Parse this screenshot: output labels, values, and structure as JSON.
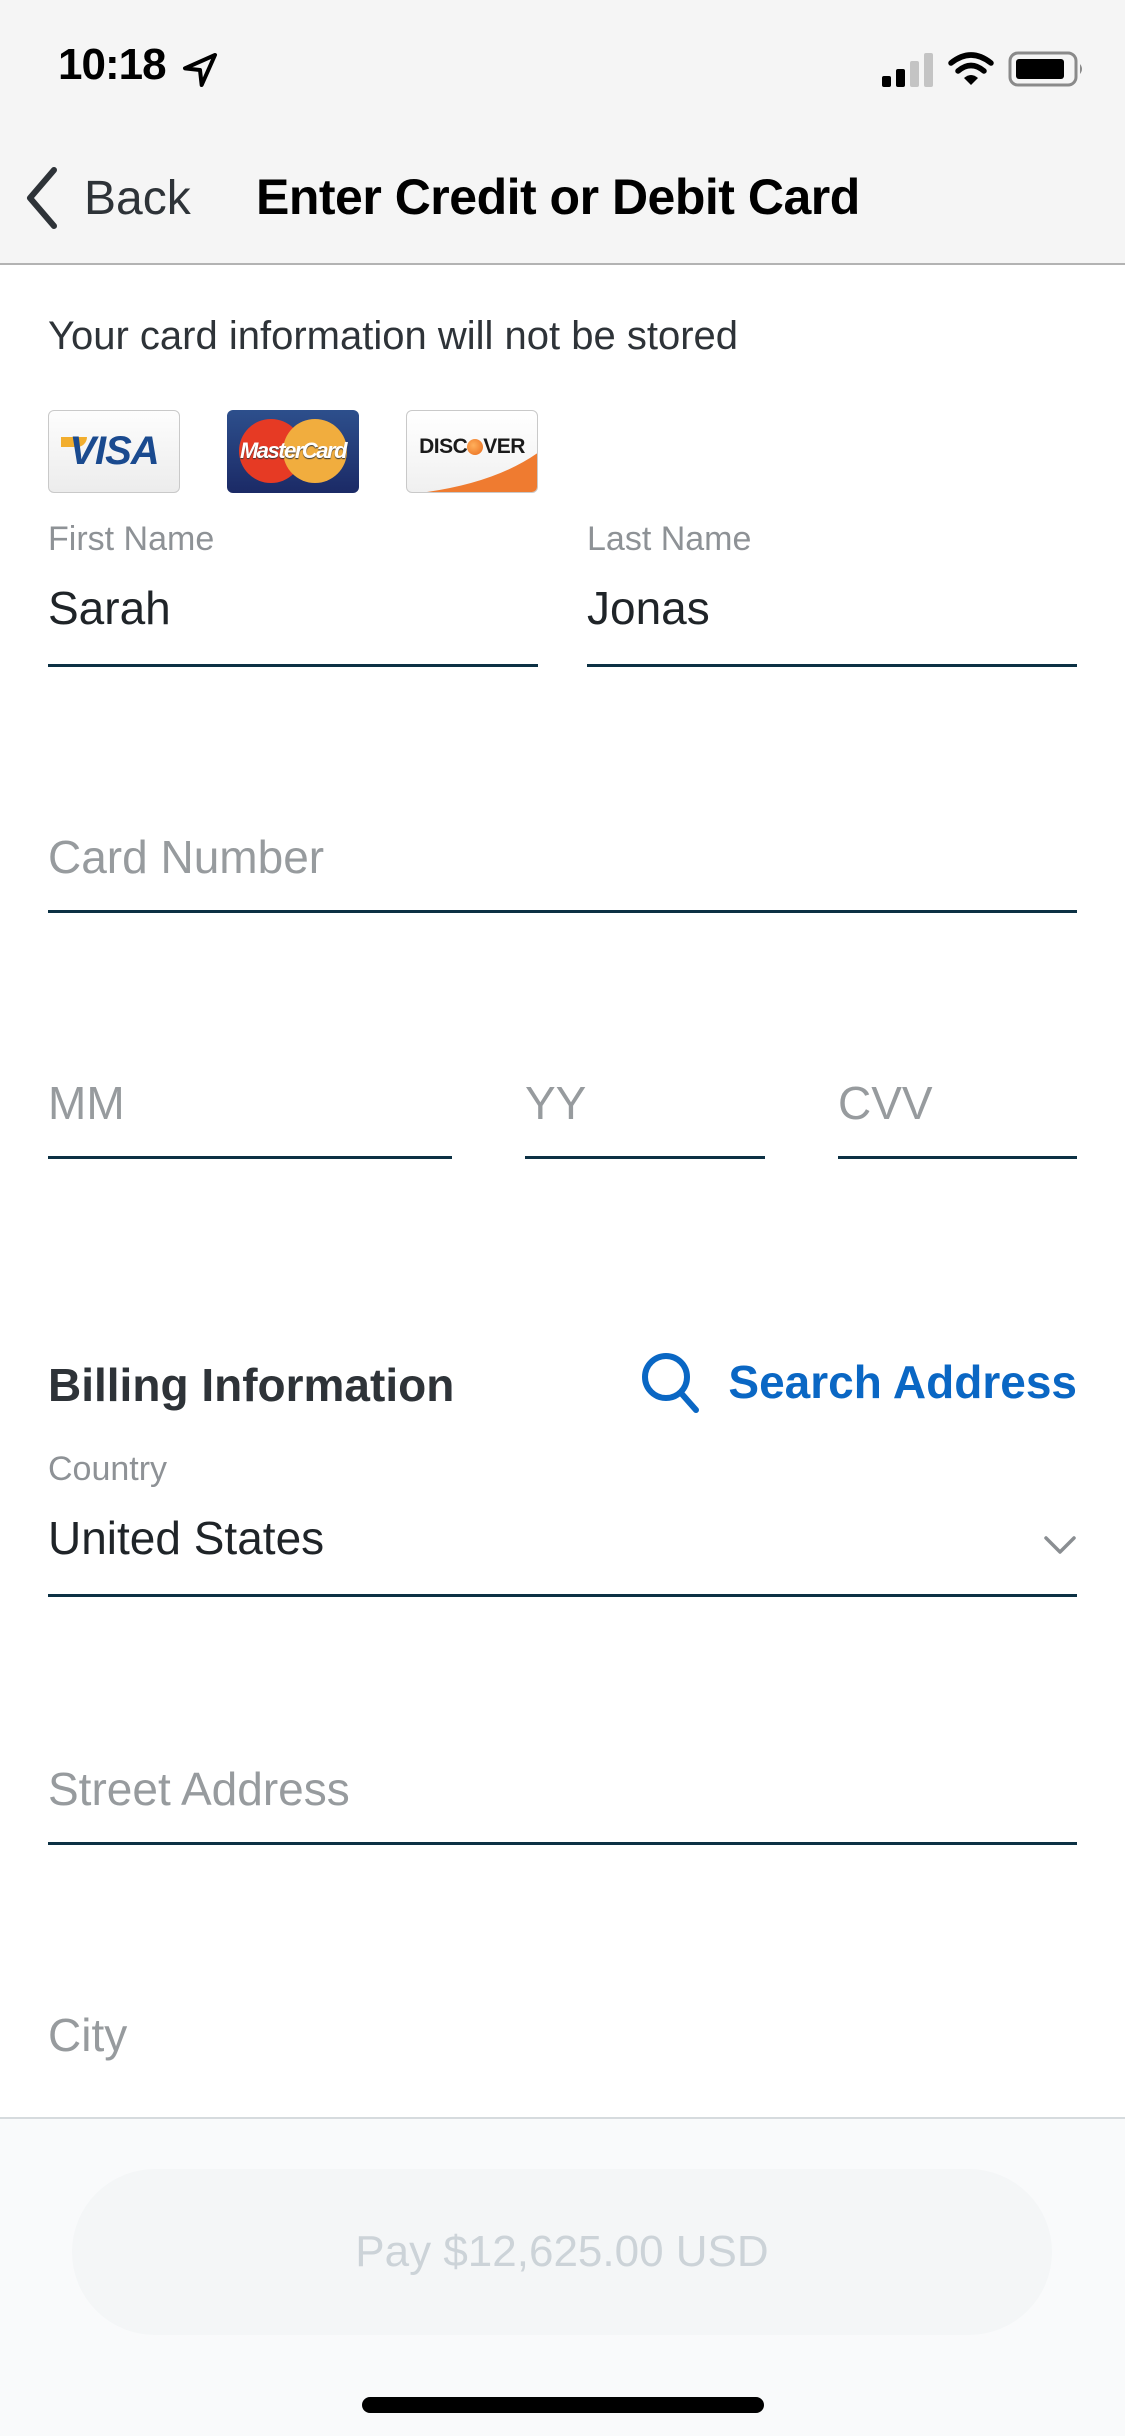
{
  "status_bar": {
    "time": "10:18",
    "icons": [
      "location-arrow-icon",
      "cellular-signal-icon",
      "wifi-icon",
      "battery-icon"
    ]
  },
  "nav": {
    "back_label": "Back",
    "title": "Enter Credit or Debit Card"
  },
  "notice": "Your card information will not be stored",
  "accepted_cards": [
    {
      "name": "visa",
      "label": "VISA"
    },
    {
      "name": "mastercard",
      "label": "MasterCard"
    },
    {
      "name": "discover",
      "label_pre": "DISC",
      "label_post": "VER"
    }
  ],
  "form": {
    "first_name": {
      "label": "First Name",
      "value": "Sarah"
    },
    "last_name": {
      "label": "Last Name",
      "value": "Jonas"
    },
    "card_number": {
      "placeholder": "Card Number"
    },
    "exp_month": {
      "placeholder": "MM"
    },
    "exp_year": {
      "placeholder": "YY"
    },
    "cvv": {
      "placeholder": "CVV"
    }
  },
  "billing": {
    "title": "Billing Information",
    "search_address_label": "Search Address",
    "country": {
      "label": "Country",
      "value": "United States"
    },
    "street_address": {
      "placeholder": "Street Address"
    },
    "city": {
      "placeholder": "City"
    }
  },
  "pay_button": {
    "label": "Pay $12,625.00 USD",
    "enabled": false
  },
  "colors": {
    "accent": "#0a67c4",
    "field_underline": "#0c3144",
    "placeholder": "#979b9e",
    "disabled_button_text": "#ccd3d8"
  }
}
